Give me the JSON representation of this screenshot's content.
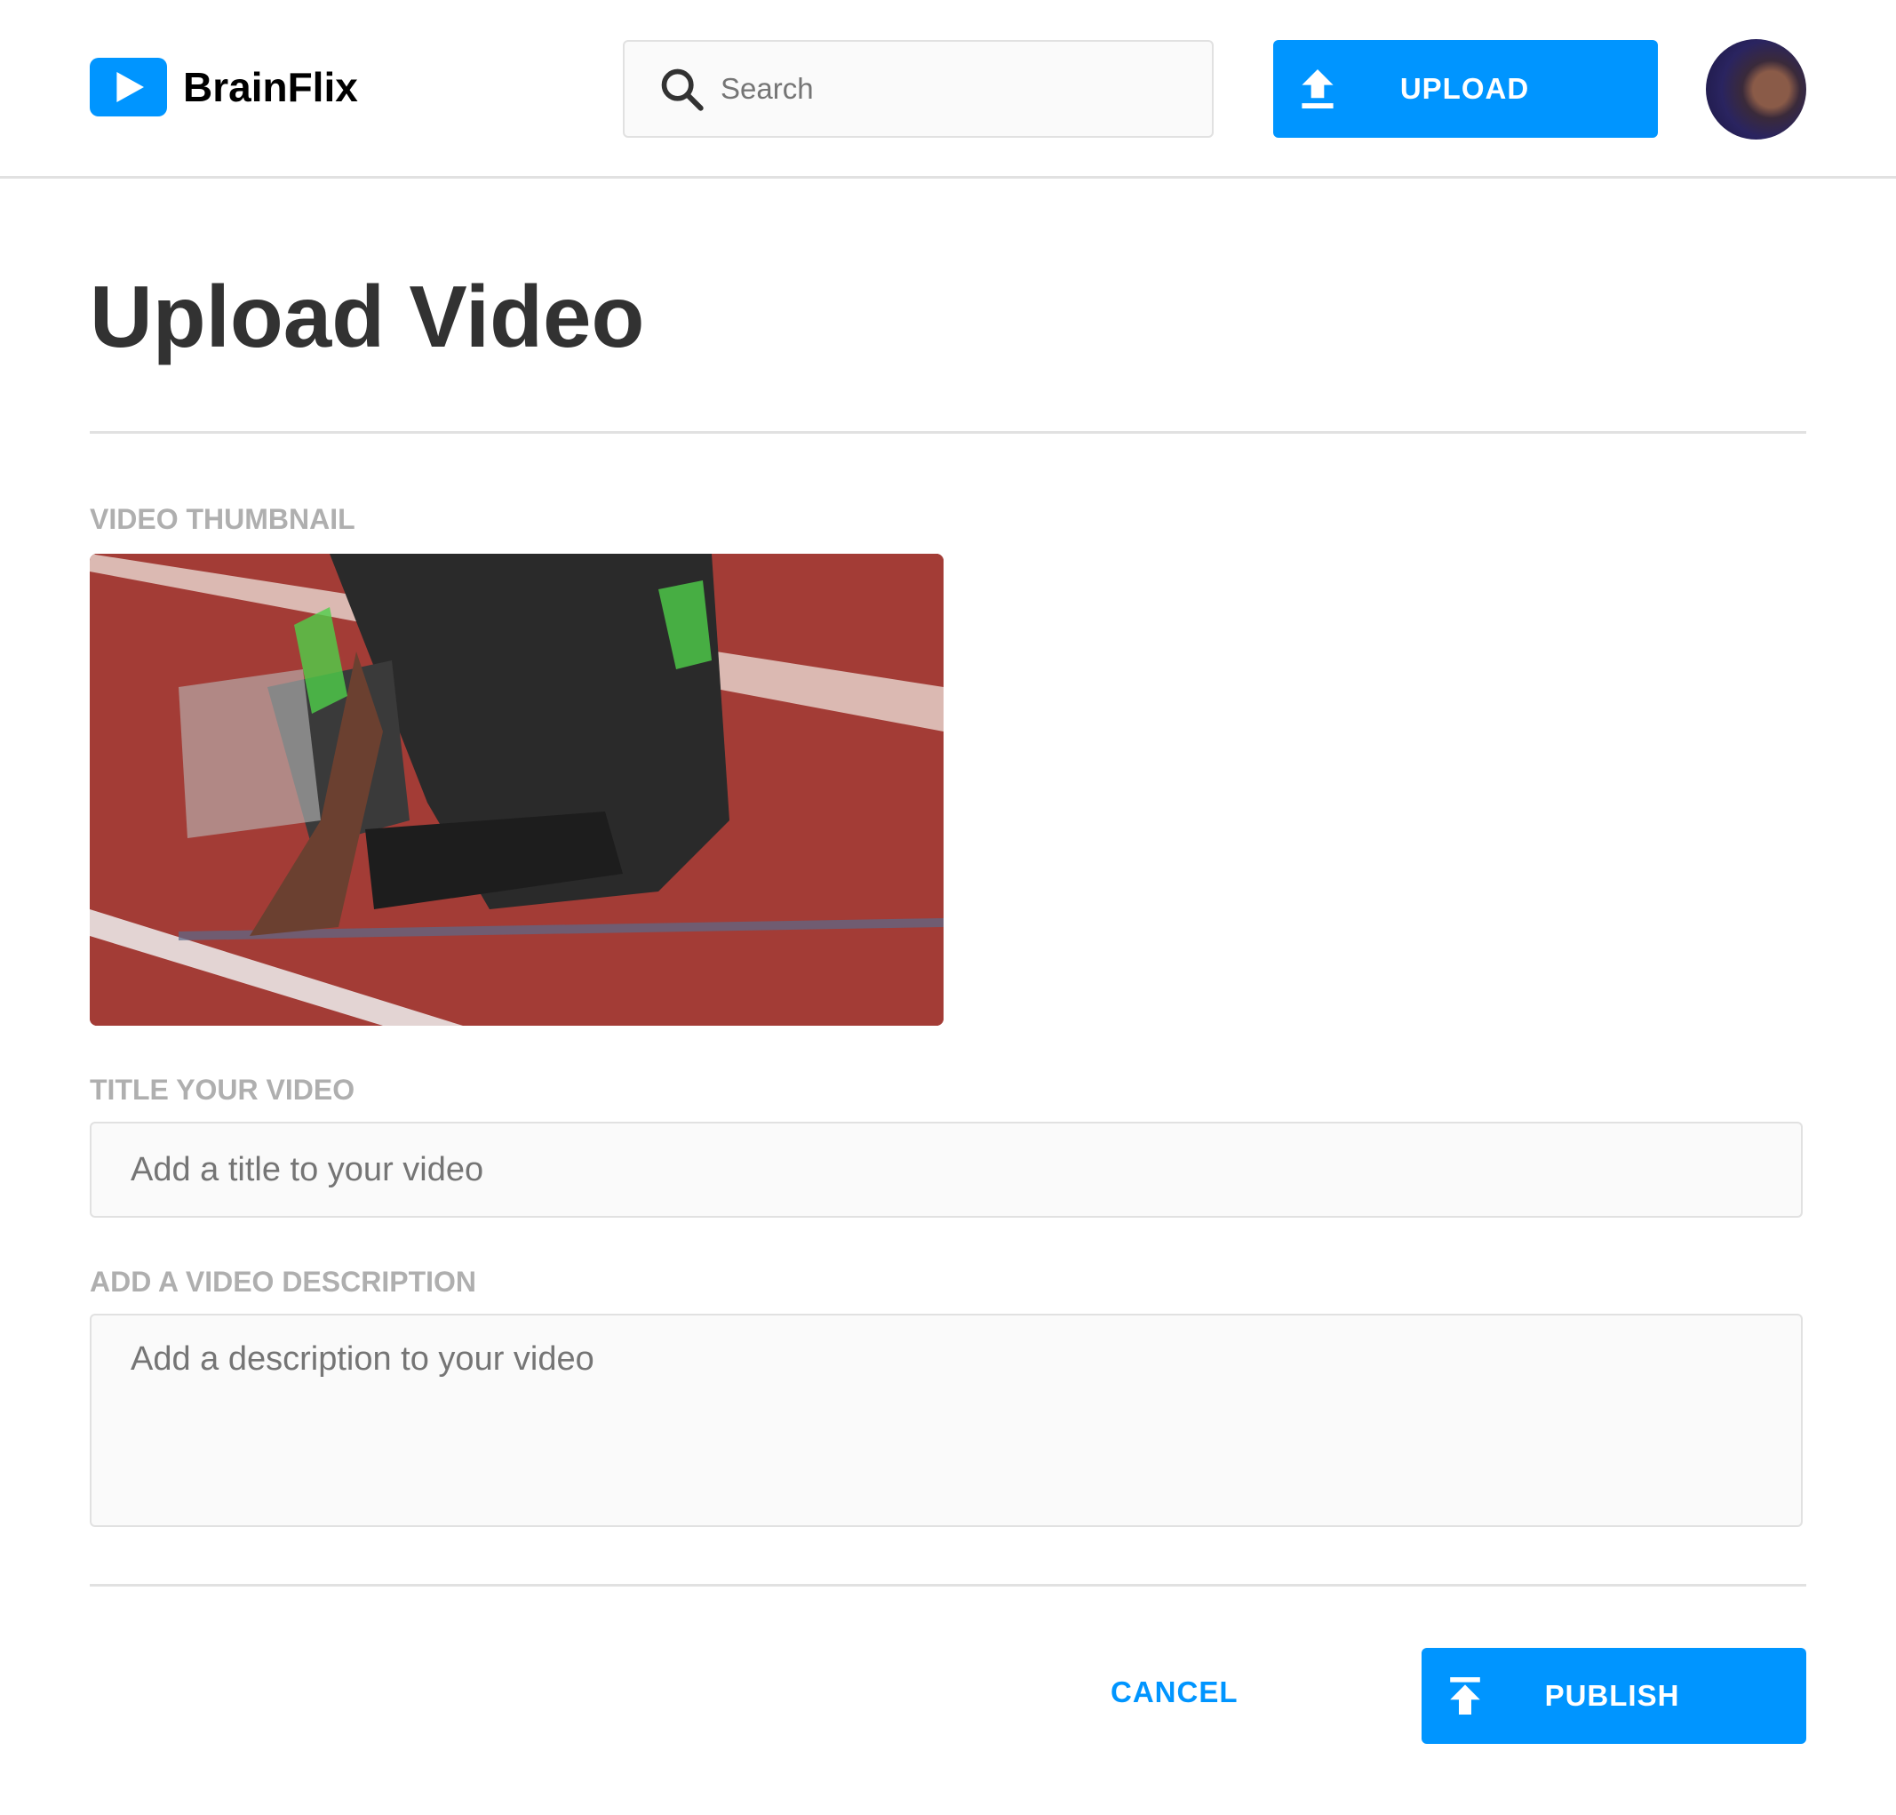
{
  "header": {
    "brand": "BrainFlix",
    "search_placeholder": "Search",
    "upload_label": "UPLOAD"
  },
  "page": {
    "title": "Upload Video",
    "thumbnail_label": "VIDEO THUMBNAIL",
    "title_label": "TITLE YOUR VIDEO",
    "title_placeholder": "Add a title to your video",
    "description_label": "ADD A VIDEO DESCRIPTION",
    "description_placeholder": "Add a description to your video",
    "cancel_label": "CANCEL",
    "publish_label": "PUBLISH"
  },
  "colors": {
    "accent": "#0095ff",
    "border": "#e1e1e1",
    "label": "#afafaf"
  }
}
